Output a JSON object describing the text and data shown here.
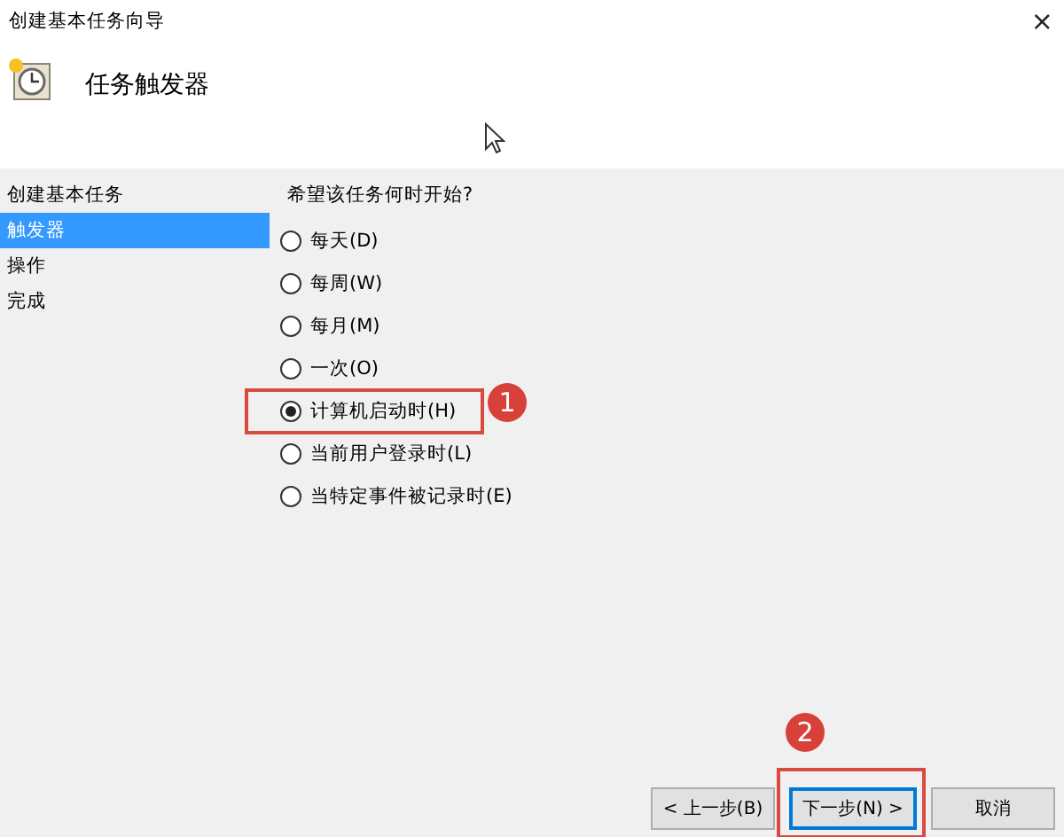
{
  "window": {
    "title": "创建基本任务向导",
    "close": "×"
  },
  "header": {
    "title": "任务触发器"
  },
  "sidebar": {
    "items": [
      {
        "label": "创建基本任务",
        "selected": false
      },
      {
        "label": "触发器",
        "selected": true
      },
      {
        "label": "操作",
        "selected": false
      },
      {
        "label": "完成",
        "selected": false
      }
    ]
  },
  "prompt": "希望该任务何时开始?",
  "options": [
    {
      "label": "每天(D)",
      "selected": false
    },
    {
      "label": "每周(W)",
      "selected": false
    },
    {
      "label": "每月(M)",
      "selected": false
    },
    {
      "label": "一次(O)",
      "selected": false
    },
    {
      "label": "计算机启动时(H)",
      "selected": true,
      "callout": "1"
    },
    {
      "label": "当前用户登录时(L)",
      "selected": false
    },
    {
      "label": "当特定事件被记录时(E)",
      "selected": false
    }
  ],
  "buttons": [
    {
      "label": "< 上一步(B)",
      "focused": false
    },
    {
      "label": "下一步(N) >",
      "focused": true,
      "callout": "2"
    },
    {
      "label": "取消",
      "focused": false
    }
  ]
}
